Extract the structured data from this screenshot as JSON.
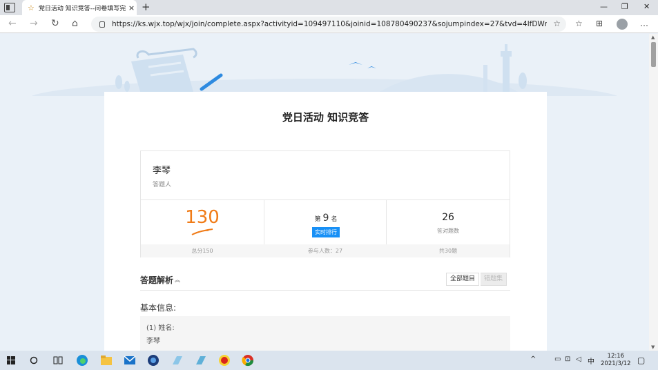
{
  "browser": {
    "tab_title": "党日活动 知识竞答--问卷填写完",
    "tab_close": "×",
    "new_tab": "+",
    "url": "https://ks.wjx.top/wjx/join/complete.aspx?activityid=109497110&joinid=108780490237&sojumpindex=27&tvd=4lfDWn3KCF...",
    "window_controls": [
      "—",
      "❐",
      "✕"
    ],
    "nav_icons": [
      "←",
      "→",
      "↻",
      "⌂"
    ],
    "toolbar_icons": [
      "☆",
      "⊞",
      "…"
    ]
  },
  "survey": {
    "title": "党日活动 知识竞答",
    "respondent_name": "李琴",
    "respondent_label": "答题人",
    "score": "130",
    "total_label": "总分150",
    "rank_prefix": "第",
    "rank_value": "9",
    "rank_suffix": "名",
    "rank_button": "实时排行",
    "participants_label": "参与人数：27",
    "correct_count": "26",
    "correct_label": "答对题数",
    "question_total": "共30题",
    "analysis_label": "答题解析",
    "analysis_toggle": "︽",
    "filter_all": "全部题目",
    "filter_wrong": "错题集",
    "basic_info_label": "基本信息:",
    "question_1": "(1) 姓名:",
    "answer_1": "李琴"
  },
  "taskbar": {
    "time": "12:16",
    "date": "2021/3/12",
    "ime": "中",
    "tray_up": "^"
  },
  "colors": {
    "score_orange": "#f07b17",
    "rank_blue": "#1890f6"
  }
}
